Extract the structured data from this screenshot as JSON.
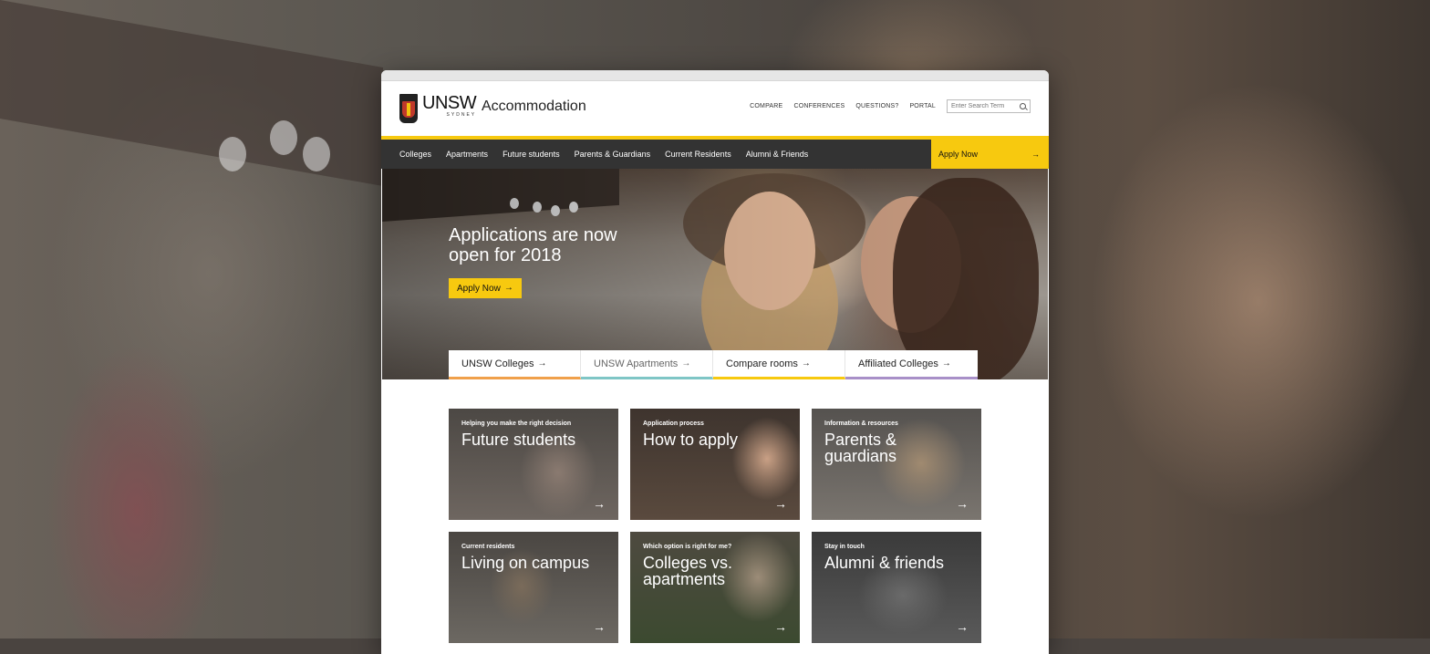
{
  "header": {
    "brand": "UNSW",
    "brand_sub": "SYDNEY",
    "site_title": "Accommodation",
    "utility_links": [
      "COMPARE",
      "CONFERENCES",
      "QUESTIONS?",
      "PORTAL"
    ],
    "search_placeholder": "Enter Search Term"
  },
  "nav": {
    "items": [
      "Colleges",
      "Apartments",
      "Future students",
      "Parents & Guardians",
      "Current Residents",
      "Alumni & Friends"
    ],
    "apply_label": "Apply Now",
    "accent": "#f7c90f"
  },
  "hero": {
    "headline": "Applications are now open for 2018",
    "cta_label": "Apply Now",
    "tabs": [
      {
        "label": "UNSW Colleges",
        "underline": "#f0a04b"
      },
      {
        "label": "UNSW Apartments",
        "underline": "#7fc6c6"
      },
      {
        "label": "Compare rooms",
        "underline": "#f7c90f"
      },
      {
        "label": "Affiliated Colleges",
        "underline": "#a890c8"
      }
    ]
  },
  "tiles": [
    {
      "eyebrow": "Helping you make the right decision",
      "title": "Future students"
    },
    {
      "eyebrow": "Application process",
      "title": "How to apply"
    },
    {
      "eyebrow": "Information & resources",
      "title": "Parents & guardians"
    },
    {
      "eyebrow": "Current residents",
      "title": "Living on campus"
    },
    {
      "eyebrow": "Which option is right for me?",
      "title": "Colleges vs. apartments"
    },
    {
      "eyebrow": "Stay in touch",
      "title": "Alumni & friends"
    }
  ],
  "icons": {
    "arrow": "arrow-right-icon",
    "search": "search-icon",
    "crest": "unsw-crest-icon"
  }
}
